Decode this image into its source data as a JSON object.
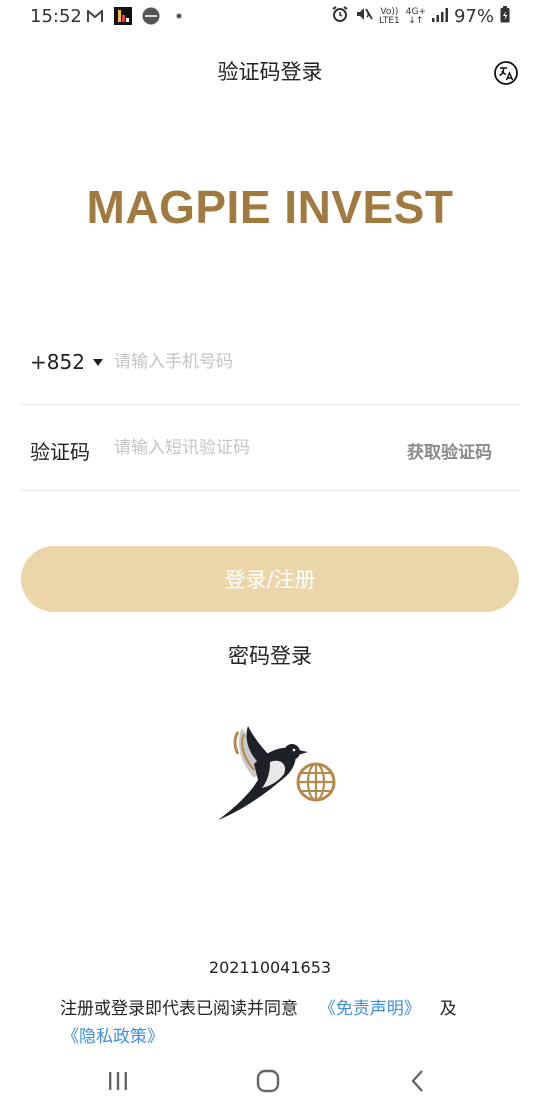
{
  "status_bar": {
    "time": "15:52",
    "volte_top": "Vo))",
    "volte_bottom": "LTE1",
    "network_top": "4G+",
    "network_bottom": "↓↑",
    "battery": "97%"
  },
  "header": {
    "title": "验证码登录",
    "translate_icon": "translate-icon"
  },
  "brand": {
    "name": "MAGPIE INVEST",
    "color": "#a07a3e"
  },
  "form": {
    "country_code": "+852",
    "phone_placeholder": "请输入手机号码",
    "code_label": "验证码",
    "code_placeholder": "请输入短讯验证码",
    "get_code_label": "获取验证码"
  },
  "actions": {
    "login_label": "登录/注册",
    "login_color": "#ebd6aa",
    "password_login_label": "密码登录"
  },
  "footer": {
    "version": "202110041653",
    "agreement_text": "注册或登录即代表已阅读并同意",
    "disclaimer_link": "《免责声明》",
    "and_text": "及",
    "privacy_link": "《隐私政策》",
    "link_color": "#3d8fe0"
  },
  "nav": {
    "recent_icon": "recent-apps-icon",
    "home_icon": "home-icon",
    "back_icon": "back-icon"
  }
}
